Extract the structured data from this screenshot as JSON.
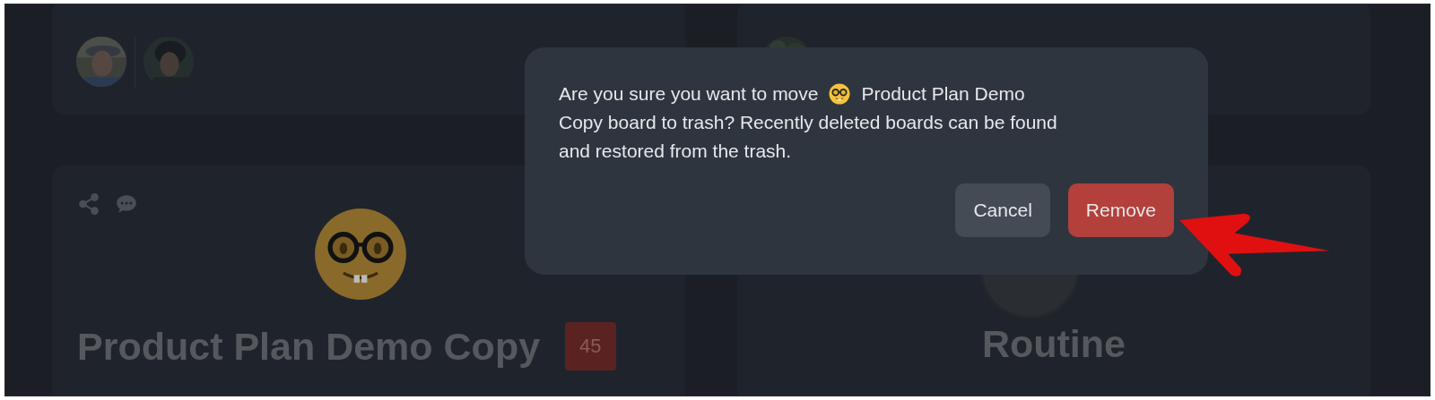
{
  "boards": [
    {
      "title": "Product Plan Demo Copy",
      "count": "45"
    },
    {
      "title": "Routine"
    }
  ],
  "dialog": {
    "message_before": "Are you sure you want to move",
    "message_after": "Product Plan Demo",
    "message_rest": "Copy board to trash? Recently deleted boards can be found and restored from the trash.",
    "buttons": [
      {
        "label": "Cancel",
        "kind": "secondary"
      },
      {
        "label": "Remove",
        "kind": "danger"
      }
    ]
  }
}
